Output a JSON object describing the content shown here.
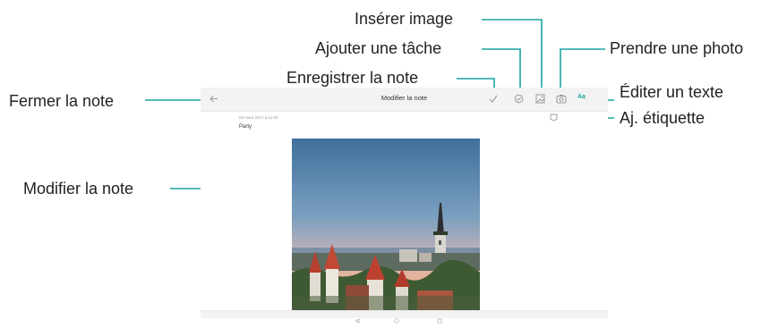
{
  "screen": {
    "app_title": "Modifier la note",
    "note_date": "06 mars 2017 à 11:00",
    "note_title": "Party",
    "text_button_label": "Aa"
  },
  "callouts": {
    "inserer_image": "Insérer image",
    "ajouter_tache": "Ajouter une tâche",
    "enregistrer_note": "Enregistrer la note",
    "fermer_note": "Fermer la note",
    "prendre_photo": "Prendre une photo",
    "editer_texte": "Éditer un texte",
    "etiquette": "Aj. étiquette",
    "modifier_note": "Modifier la note"
  },
  "icons": [
    "back-arrow-icon",
    "checkmark-icon",
    "task-icon",
    "image-icon",
    "camera-icon",
    "text-format-icon",
    "tag-icon"
  ],
  "colors": {
    "accent": "#1aa3a1"
  }
}
